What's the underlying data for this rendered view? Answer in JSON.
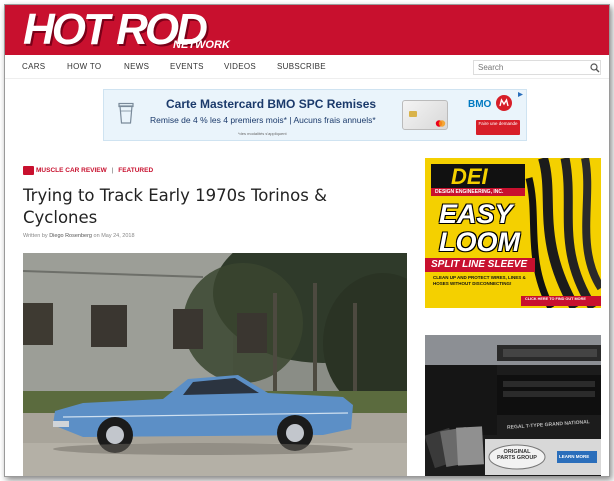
{
  "site": {
    "logo_text": "HOT ROD",
    "logo_sub": "NETWORK"
  },
  "nav": {
    "items": [
      "CARS",
      "HOW TO",
      "NEWS",
      "EVENTS",
      "VIDEOS",
      "SUBSCRIBE"
    ],
    "search_placeholder": "Search"
  },
  "banner_ad": {
    "title": "Carte Mastercard BMO SPC Remises",
    "subtitle": "Remise de 4 % les 4 premiers mois* | Aucuns frais annuels*",
    "fine_print": "*des modalités s'appliquent",
    "brand": "BMO",
    "cta": "Faire une demande"
  },
  "article": {
    "category_primary": "MUSCLE CAR REVIEW",
    "category_separator": "|",
    "category_secondary": "FEATURED",
    "title": "Trying to Track Early 1970s Torinos & Cyclones",
    "byline_prefix": "Written by",
    "author": "Diego Rosenberg",
    "byline_mid": "on",
    "date": "May 24, 2018"
  },
  "dei_ad": {
    "brand": "DEI",
    "brand_sub": "DESIGN ENGINEERING, INC.",
    "headline_1": "EASY",
    "headline_2": "LOOM",
    "strip": "SPLIT LINE SLEEVE",
    "body": "CLEAN UP AND PROTECT WIRES, LINES & HOSES WITHOUT DISCONNECTING!",
    "cta": "CLICK HERE TO FIND OUT MORE"
  },
  "grille_ad": {
    "car_badge": "REGAL T-TYPE GRAND NATIONAL",
    "brand": "ORIGINAL PARTS GROUP",
    "cta": "LEARN MORE"
  },
  "colors": {
    "header_red": "#c8102e",
    "banner_bg": "#eaf4fb",
    "dei_yellow": "#f4d000",
    "bmo_red": "#d71e28",
    "bmo_blue": "#0079c1"
  }
}
